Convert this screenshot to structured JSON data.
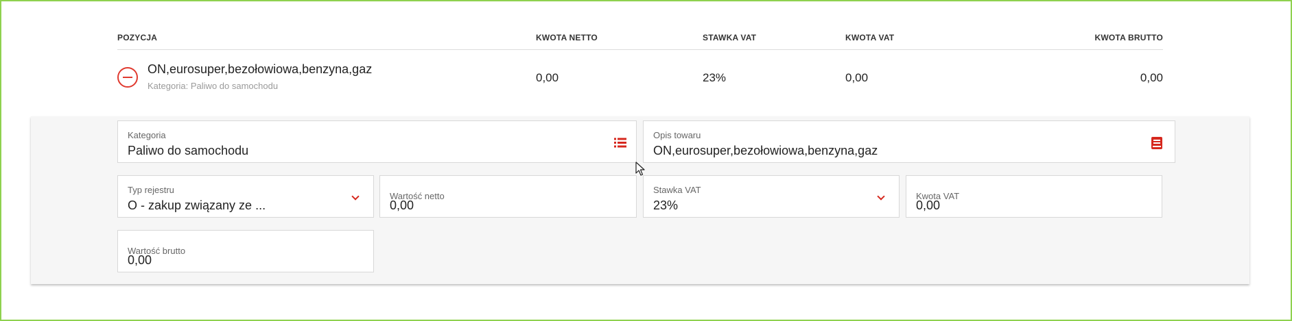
{
  "table": {
    "headers": {
      "pozycja": "POZYCJA",
      "kwota_netto": "KWOTA NETTO",
      "stawka_vat": "STAWKA VAT",
      "kwota_vat": "KWOTA VAT",
      "kwota_brutto": "KWOTA BRUTTO"
    },
    "row": {
      "name": "ON,eurosuper,bezołowiowa,benzyna,gaz",
      "category": "Kategoria: Paliwo do samochodu",
      "kwota_netto": "0,00",
      "stawka_vat": "23%",
      "kwota_vat": "0,00",
      "kwota_brutto": "0,00",
      "remove_icon": "minus-circle-icon"
    }
  },
  "form": {
    "kategoria": {
      "label": "Kategoria",
      "value": "Paliwo do samochodu",
      "icon": "list-icon"
    },
    "opis_towaru": {
      "label": "Opis towaru",
      "value": "ON,eurosuper,bezołowiowa,benzyna,gaz",
      "icon": "book-icon"
    },
    "typ_rejestru": {
      "label": "Typ rejestru",
      "value": "O - zakup związany ze ...",
      "icon": "chevron-down-icon"
    },
    "wartosc_netto": {
      "label": "Wartość netto",
      "value": "0,00"
    },
    "stawka_vat": {
      "label": "Stawka VAT",
      "value": "23%",
      "icon": "chevron-down-icon"
    },
    "kwota_vat": {
      "label": "Kwota VAT",
      "value": "0,00"
    },
    "wartosc_brutto": {
      "label": "Wartość brutto",
      "value": "0,00"
    }
  },
  "colors": {
    "accent": "#d6281e",
    "frame": "#8fd14f",
    "panel_bg": "#f6f6f6"
  }
}
